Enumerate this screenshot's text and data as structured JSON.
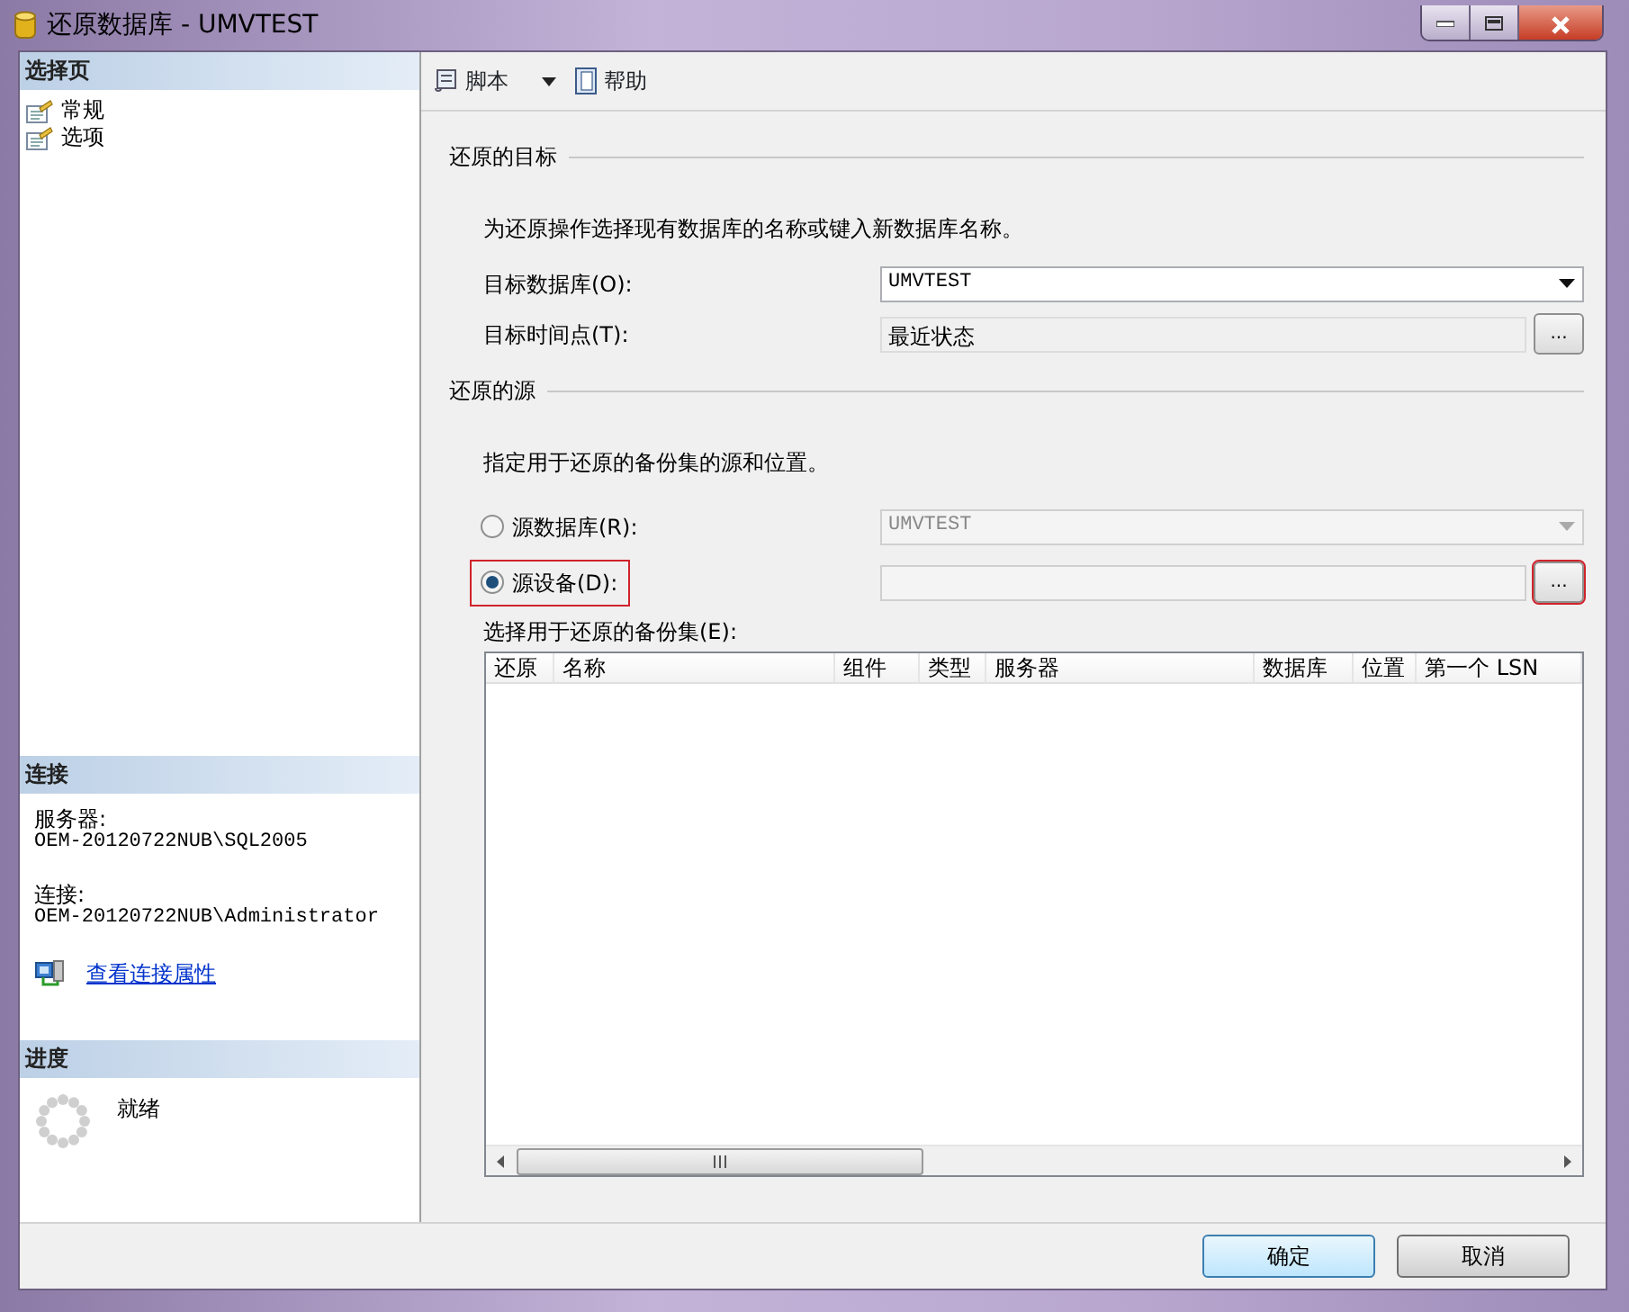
{
  "window": {
    "title": "还原数据库 - UMVTEST"
  },
  "sidebar": {
    "pages_header": "选择页",
    "pages": [
      {
        "label": "常规",
        "selected": false
      },
      {
        "label": "选项",
        "selected": false
      }
    ],
    "connection": {
      "header": "连接",
      "server_label": "服务器:",
      "server": "OEM-20120722NUB\\SQL2005",
      "connection_label": "连接:",
      "connection": "OEM-20120722NUB\\Administrator",
      "link": "查看连接属性"
    },
    "progress": {
      "header": "进度",
      "status": "就绪"
    }
  },
  "toolbar": [
    {
      "label": "脚本",
      "kind": "dropdown"
    },
    {
      "label": "帮助",
      "kind": "plain"
    }
  ],
  "destination": {
    "header": "还原的目标",
    "description": "为还原操作选择现有数据库的名称或键入新数据库名称。",
    "fields": [
      {
        "label": "目标数据库(O):",
        "value": "UMVTEST",
        "kind": "dropdown"
      },
      {
        "label": "目标时间点(T):",
        "value": "最近状态",
        "kind": "browse",
        "button": "..."
      }
    ]
  },
  "source": {
    "header": "还原的源",
    "description": "指定用于还原的备份集的源和位置。",
    "options": [
      {
        "label": "源数据库(R):",
        "value": "UMVTEST",
        "kind": "dropdown",
        "selected": false,
        "highlighted": false
      },
      {
        "label": "源设备(D):",
        "kind": "browse",
        "button": "...",
        "selected": true,
        "highlighted": true
      }
    ]
  },
  "backup_sets": {
    "label": "选择用于还原的备份集(E):",
    "columns": [
      "还原",
      "名称",
      "组件",
      "类型",
      "服务器",
      "数据库",
      "位置",
      "第一个 LSN"
    ]
  },
  "buttons": [
    {
      "label": "确定",
      "default": true
    },
    {
      "label": "取消",
      "default": false
    }
  ]
}
